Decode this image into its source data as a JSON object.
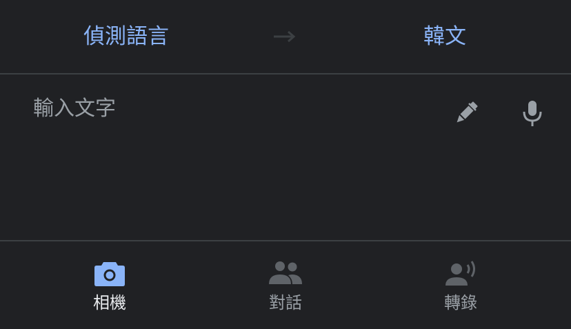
{
  "languages": {
    "source": "偵測語言",
    "target": "韓文"
  },
  "input": {
    "placeholder": "輸入文字"
  },
  "tabs": [
    {
      "label": "相機",
      "icon": "camera-icon",
      "active": true
    },
    {
      "label": "對話",
      "icon": "people-icon",
      "active": false
    },
    {
      "label": "轉錄",
      "icon": "transcribe-icon",
      "active": false
    }
  ],
  "colors": {
    "background": "#202124",
    "accent": "#8ab4f8",
    "muted": "#9aa0a6",
    "divider": "#3c4043"
  }
}
